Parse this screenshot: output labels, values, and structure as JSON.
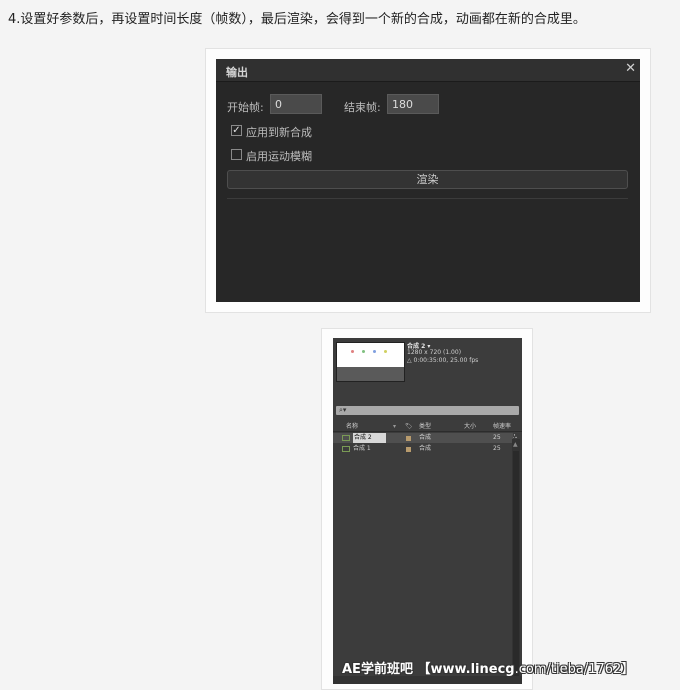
{
  "intro": "4.设置好参数后，再设置时间长度（帧数），最后渲染，会得到一个新的合成，动画都在新的合成里。",
  "dialog": {
    "title": "输出",
    "close": "✕",
    "start_label": "开始帧:",
    "start_value": "0",
    "end_label": "结束帧:",
    "end_value": "180",
    "apply_label": "应用到新合成",
    "apply_checked": true,
    "motion_blur_label": "启用运动模糊",
    "motion_blur_checked": false,
    "render_button": "渲染"
  },
  "project_panel": {
    "comp_name": "合成 2 ▾",
    "comp_size": "1280 x 720 (1.00)",
    "comp_duration": "△ 0:00:35:00, 25.00 fps",
    "search_icon": "⌕▾",
    "columns": {
      "name": "名称",
      "type": "类型",
      "size": "大小",
      "fps": "帧速率"
    },
    "rows": [
      {
        "name": "合成 2",
        "type": "合成",
        "fps": "25"
      },
      {
        "name": "合成 1",
        "type": "合成",
        "fps": "25"
      }
    ],
    "dot_colors": [
      "#e08080",
      "#80c080",
      "#80a0e0",
      "#d0d060"
    ]
  },
  "watermark": {
    "text": "AE学前班吧 【www.linecg",
    "text2": ".com/tieba/1762】"
  }
}
